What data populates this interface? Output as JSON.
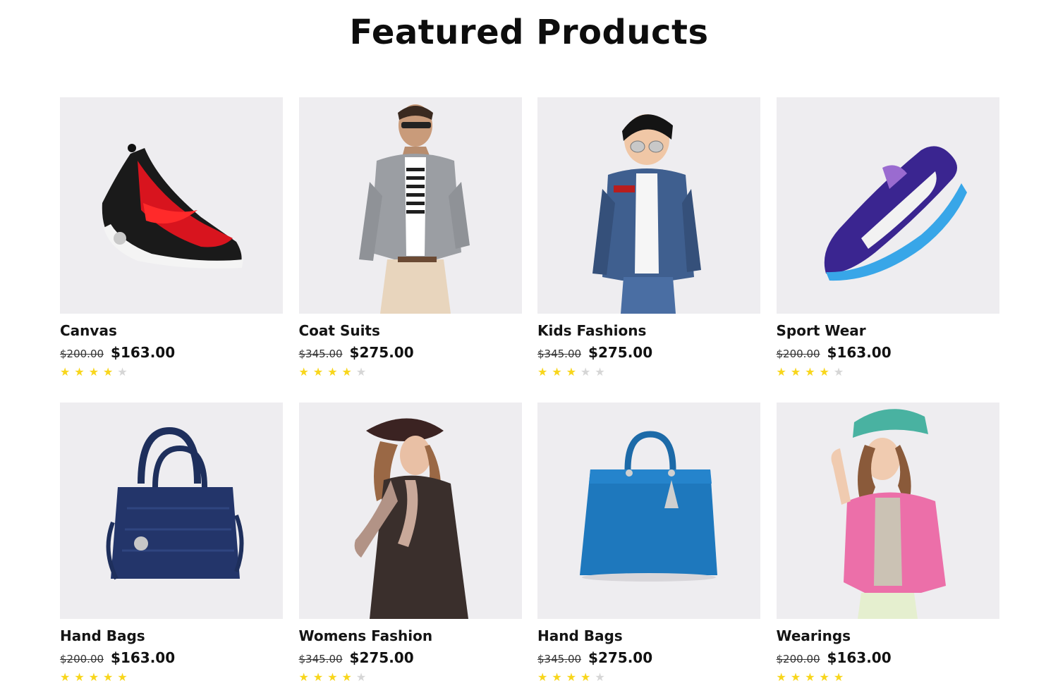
{
  "section": {
    "title": "Featured Products"
  },
  "products": [
    {
      "name": "Canvas",
      "old_price": "$200.00",
      "price": "$163.00",
      "rating": 4,
      "image": "red-sneaker"
    },
    {
      "name": "Coat Suits",
      "old_price": "$345.00",
      "price": "$275.00",
      "rating": 4,
      "image": "man-in-blazer"
    },
    {
      "name": "Kids Fashions",
      "old_price": "$345.00",
      "price": "$275.00",
      "rating": 3,
      "image": "boy-in-denim-jacket"
    },
    {
      "name": "Sport Wear",
      "old_price": "$200.00",
      "price": "$163.00",
      "rating": 4,
      "image": "purple-sneaker"
    },
    {
      "name": "Hand Bags",
      "old_price": "$200.00",
      "price": "$163.00",
      "rating": 5,
      "image": "navy-handbag"
    },
    {
      "name": "Womens Fashion",
      "old_price": "$345.00",
      "price": "$275.00",
      "rating": 4,
      "image": "woman-in-scarf"
    },
    {
      "name": "Hand Bags",
      "old_price": "$345.00",
      "price": "$275.00",
      "rating": 4,
      "image": "blue-handbag"
    },
    {
      "name": "Wearings",
      "old_price": "$200.00",
      "price": "$163.00",
      "rating": 5,
      "image": "woman-in-pink-jacket"
    }
  ],
  "colors": {
    "thumb_bg": "#eeedf0",
    "star_on": "#f8d61c",
    "star_off": "#d6d6d6"
  }
}
